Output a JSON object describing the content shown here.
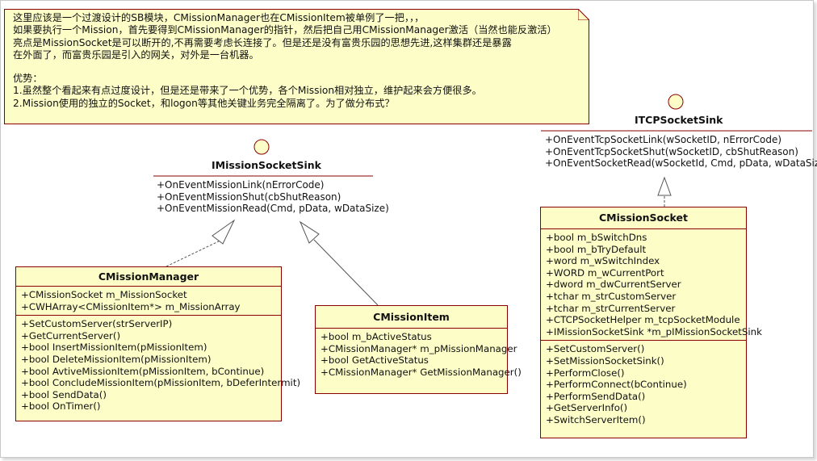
{
  "note": {
    "lines": [
      "这里应该是一个过渡设计的SB模块，CMissionManager也在CMissionItem被单例了一把，，，",
      "如果要执行一个Mission，首先要得到CMissionManager的指针，然后把自己用CMissionManager激活（当然也能反激活）",
      "亮点是MissionSocket是可以断开的,不再需要考虑长连接了。但是还是没有富贵乐园的思想先进,这样集群还是暴露",
      "在外面了，而富贵乐园是引入的网关，对外是一台机器。",
      "",
      "优势：",
      "1.虽然整个看起来有点过度设计，但是还是带来了一个优势，各个Mission相对独立，维护起来会方便很多。",
      "2.Mission使用的独立的Socket，和logon等其他关键业务完全隔离了。为了做分布式？"
    ]
  },
  "interfaces": {
    "mission_socket_sink": {
      "name": "IMissionSocketSink",
      "ops": [
        "+OnEventMissionLink(nErrorCode)",
        "+OnEventMissionShut(cbShutReason)",
        "+OnEventMissionRead(Cmd, pData, wDataSize)"
      ]
    },
    "tcp_socket_sink": {
      "name": "ITCPSocketSink",
      "ops": [
        "+OnEventTcpSocketLink(wSocketID, nErrorCode)",
        "+OnEventTcpSocketShut(wSocketID, cbShutReason)",
        "+OnEventSocketRead(wSocketId, Cmd, pData, wDataSize)"
      ]
    }
  },
  "classes": {
    "mission_manager": {
      "name": "CMissionManager",
      "attributes": [
        "+CMissionSocket m_MissionSocket",
        "+CWHArray<CMissionItem*> m_MissionArray"
      ],
      "operations": [
        "+SetCustomServer(strServerIP)",
        "+GetCurrentServer()",
        "+bool InsertMissionItem(pMissionItem)",
        "+bool DeleteMissionItem(pMissionItem)",
        "+bool AvtiveMissionItem(pMissionItem, bContinue)",
        "+bool ConcludeMissionItem(pMissionItem, bDeferIntermit)",
        "+bool SendData()",
        "+bool OnTimer()"
      ]
    },
    "mission_item": {
      "name": "CMissionItem",
      "members": [
        "+bool m_bActiveStatus",
        "+CMissionManager* m_pMissionManager",
        "+bool GetActiveStatus",
        "+CMissionManager* GetMissionManager()"
      ]
    },
    "mission_socket": {
      "name": "CMissionSocket",
      "attributes": [
        "+bool m_bSwitchDns",
        "+bool m_bTryDefault",
        "+word m_wSwitchIndex",
        "+WORD m_wCurrentPort",
        "+dword m_dwCurrentServer",
        "+tchar m_strCustomServer",
        "+tchar m_strCurrentServer",
        "+CTCPSocketHelper m_tcpSocketModule",
        "+IMissionSocketSink *m_pIMissionSocketSink"
      ],
      "operations": [
        "+SetCustomServer()",
        "+SetMissionSocketSink()",
        "+PerformClose()",
        "+PerformConnect(bContinue)",
        "+PerformSendData()",
        "+GetServerInfo()",
        "+SwitchServerItem()"
      ]
    }
  },
  "colors": {
    "fill": "#fdfdc8",
    "border": "#8a0000",
    "interface_line": "#8a0000",
    "dashed_line": "#555555"
  }
}
